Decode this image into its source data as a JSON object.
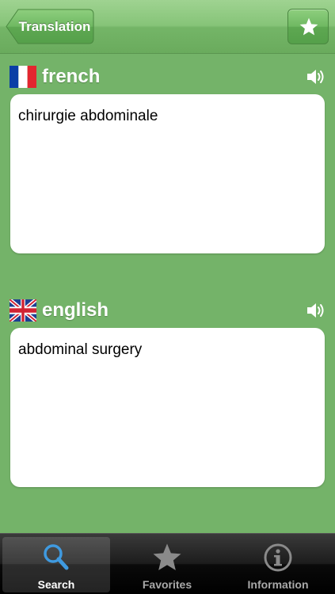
{
  "navbar": {
    "back_label": "Translation",
    "favorite_icon": "star-icon"
  },
  "source": {
    "language": "french",
    "flag": "flag-france-icon",
    "text": "chirurgie abdominale"
  },
  "target": {
    "language": "english",
    "flag": "flag-uk-icon",
    "text": "abdominal surgery"
  },
  "tabs": [
    {
      "label": "Search",
      "icon": "search-icon",
      "active": true
    },
    {
      "label": "Favorites",
      "icon": "star-icon",
      "active": false
    },
    {
      "label": "Information",
      "icon": "info-icon",
      "active": false
    }
  ],
  "colors": {
    "background": "#74b369",
    "navbar": "#86c478",
    "tab_active": "#3f9ae0"
  }
}
